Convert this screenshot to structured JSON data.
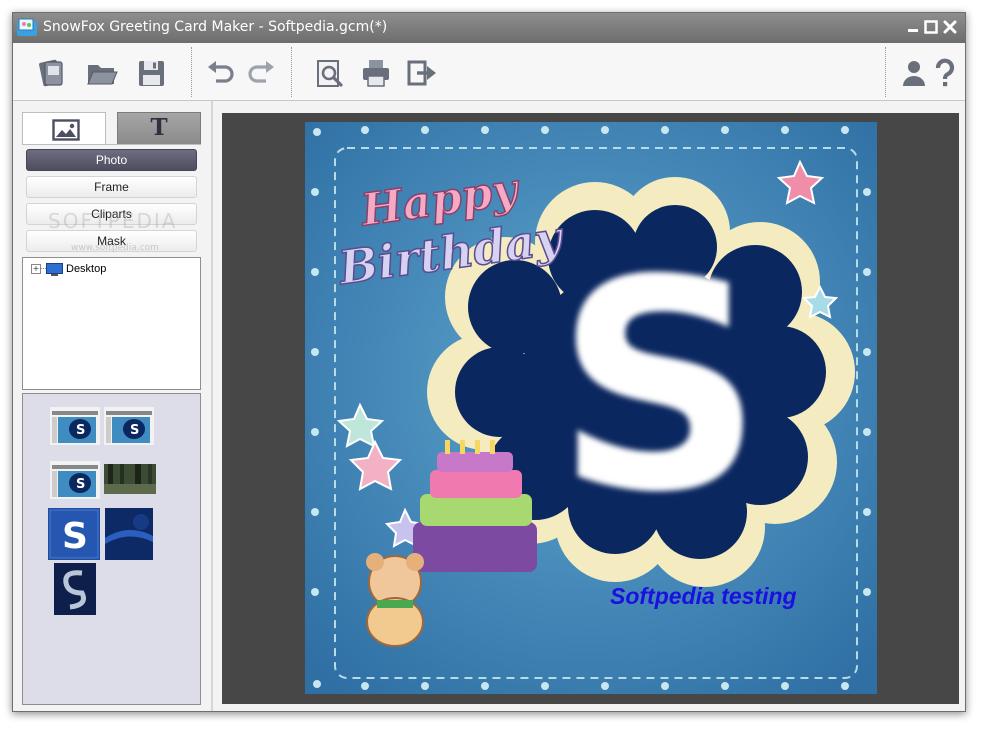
{
  "window": {
    "title": "SnowFox Greeting Card Maker - Softpedia.gcm(*)",
    "controls": [
      "minimize-icon",
      "maximize-icon",
      "close-icon"
    ]
  },
  "toolbar": {
    "groups": [
      [
        "new-card-icon",
        "open-folder-icon",
        "save-icon"
      ],
      [
        "undo-icon",
        "redo-icon"
      ],
      [
        "print-preview-icon",
        "print-icon",
        "export-icon"
      ],
      [
        "account-icon",
        "help-icon"
      ]
    ]
  },
  "sidebar": {
    "tabs": [
      {
        "icon": "picture-icon",
        "active": true
      },
      {
        "icon": "text-icon",
        "glyph": "T",
        "active": false
      }
    ],
    "categories": [
      {
        "label": "Photo",
        "active": true
      },
      {
        "label": "Frame",
        "active": false
      },
      {
        "label": "Cliparts",
        "active": false
      },
      {
        "label": "Mask",
        "active": false
      }
    ],
    "tree": {
      "items": [
        {
          "label": "Desktop",
          "expander": "+",
          "icon": "desktop-icon"
        }
      ]
    },
    "thumbnails": [
      {
        "name": "screenshot-1"
      },
      {
        "name": "screenshot-2"
      },
      {
        "name": "screenshot-3"
      },
      {
        "name": "forest-photo"
      },
      {
        "name": "softpedia-s-logo"
      },
      {
        "name": "blue-wallpaper"
      },
      {
        "name": "dark-s-logo"
      }
    ],
    "watermark": "SOFTPEDIA",
    "watermark_url": "www.softpedia.com"
  },
  "canvas": {
    "card_text": "Softpedia testing",
    "text_color": "#1a10e0",
    "card_background": "#3f8cc0",
    "frame_color": "#0b2760",
    "decoration": {
      "greeting_line1": "Happy",
      "greeting_line2": "Birthday",
      "monogram": "S"
    }
  },
  "colors": {
    "titlebar": "#7d7d7d",
    "canvas_bg": "#474747",
    "active_category": "#57576a"
  }
}
